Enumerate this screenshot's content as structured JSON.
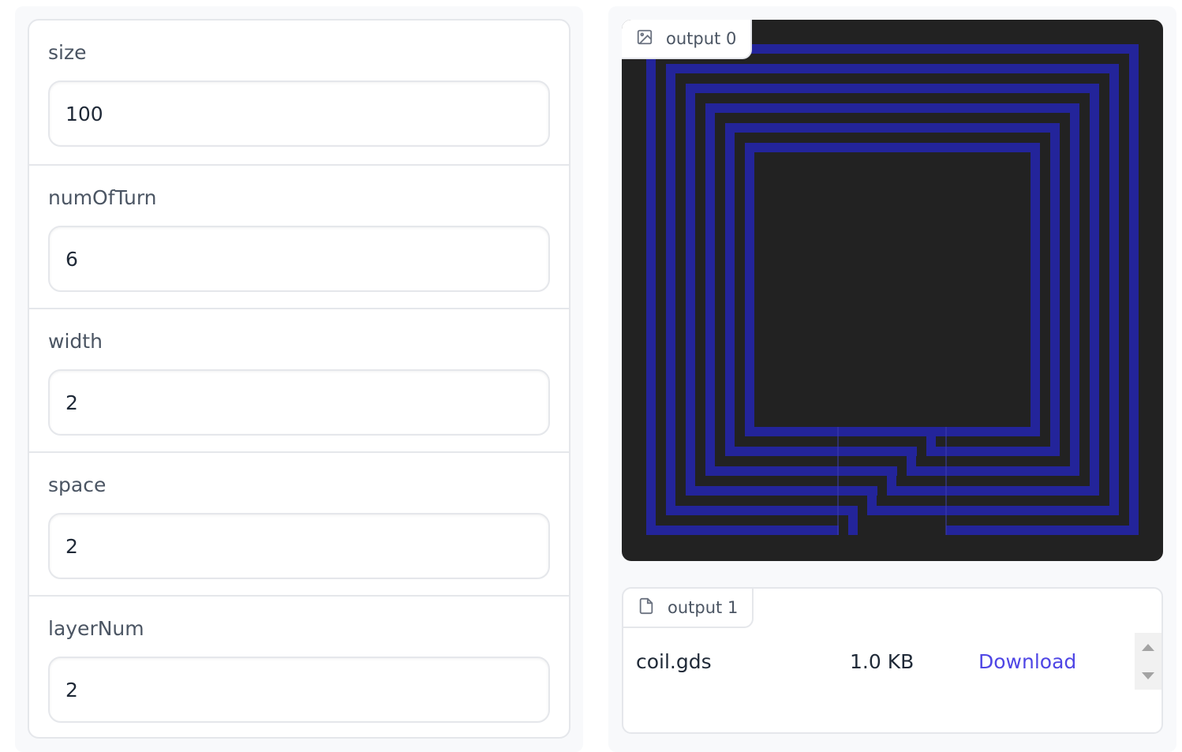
{
  "inputs": {
    "fields": [
      {
        "label": "size",
        "value": "100"
      },
      {
        "label": "numOfTurn",
        "value": "6"
      },
      {
        "label": "width",
        "value": "2"
      },
      {
        "label": "space",
        "value": "2"
      },
      {
        "label": "layerNum",
        "value": "2"
      }
    ]
  },
  "outputs": {
    "image": {
      "label": "output 0",
      "icon": "image-icon",
      "background_color": "#222222",
      "trace_color": "#23249a"
    },
    "file": {
      "label": "output 1",
      "icon": "file-icon",
      "name": "coil.gds",
      "size": "1.0 KB",
      "download_label": "Download",
      "download_color": "#4f46e5"
    }
  }
}
